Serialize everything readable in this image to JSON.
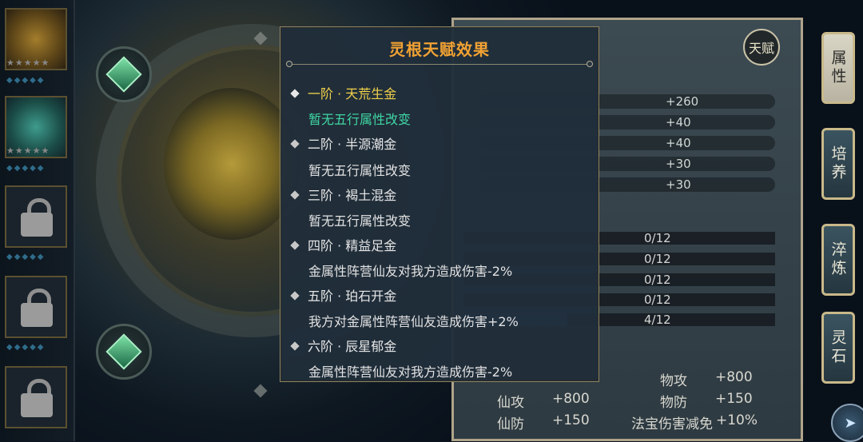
{
  "popup": {
    "title": "灵根天赋效果",
    "tiers": [
      {
        "name": "一阶 · 天荒生金",
        "effect": "暂无五行属性改变",
        "active": true
      },
      {
        "name": "二阶 · 半源潮金",
        "effect": "暂无五行属性改变",
        "active": false
      },
      {
        "name": "三阶 · 褐土混金",
        "effect": "暂无五行属性改变",
        "active": false
      },
      {
        "name": "四阶 · 精益足金",
        "effect": "金属性阵营仙友对我方造成伤害-2%",
        "active": false
      },
      {
        "name": "五阶 · 珀石开金",
        "effect": "我方对金属性阵营仙友造成伤害+2%",
        "active": false
      },
      {
        "name": "六阶 · 辰星郁金",
        "effect": "金属性阵营仙友对我方造成伤害-2%",
        "active": false
      }
    ]
  },
  "attributes": {
    "bonuses": [
      "+260",
      "+40",
      "+40",
      "+30",
      "+30"
    ],
    "progress": [
      {
        "text": "0/12",
        "value": 0
      },
      {
        "text": "0/12",
        "value": 0
      },
      {
        "text": "0/12",
        "value": 0
      },
      {
        "text": "0/12",
        "value": 0
      },
      {
        "text": "4/12",
        "value": 0.333
      }
    ],
    "stats": [
      {
        "label": "物攻",
        "value": "+800"
      },
      {
        "label": "仙攻",
        "value": "+800"
      },
      {
        "label": "物防",
        "value": "+150"
      },
      {
        "label": "仙防",
        "value": "+150"
      },
      {
        "label": "法宝伤害减免",
        "value": "+10%"
      }
    ]
  },
  "talent_badge": "天赋",
  "tabs": [
    "属性",
    "培养",
    "淬炼",
    "灵石"
  ],
  "active_tab": "属性",
  "colors": {
    "title": "#f2a233",
    "active_tier": "#f1d14a",
    "active_effect": "#3fd6a3",
    "text": "#e2e2e2"
  }
}
